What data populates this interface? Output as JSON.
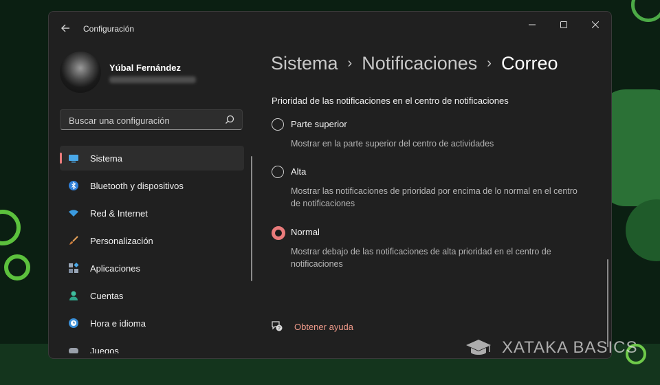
{
  "window": {
    "title": "Configuración"
  },
  "user": {
    "name": "Yúbal Fernández"
  },
  "search": {
    "placeholder": "Buscar una configuración"
  },
  "sidebar": {
    "items": [
      {
        "label": "Sistema",
        "icon": "monitor-icon",
        "active": true
      },
      {
        "label": "Bluetooth y dispositivos",
        "icon": "bluetooth-icon"
      },
      {
        "label": "Red & Internet",
        "icon": "wifi-icon"
      },
      {
        "label": "Personalización",
        "icon": "brush-icon"
      },
      {
        "label": "Aplicaciones",
        "icon": "apps-icon"
      },
      {
        "label": "Cuentas",
        "icon": "account-icon"
      },
      {
        "label": "Hora e idioma",
        "icon": "clock-globe-icon"
      },
      {
        "label": "Juegos",
        "icon": "gamepad-icon"
      }
    ]
  },
  "breadcrumb": {
    "part1": "Sistema",
    "part2": "Notificaciones",
    "current": "Correo",
    "separator": "›"
  },
  "main": {
    "section_title": "Prioridad de las notificaciones en el centro de notificaciones",
    "options": [
      {
        "label": "Parte superior",
        "description": "Mostrar en la parte superior del centro de actividades",
        "selected": false
      },
      {
        "label": "Alta",
        "description": "Mostrar las notificaciones de prioridad por encima de lo normal en el centro de notificaciones",
        "selected": false
      },
      {
        "label": "Normal",
        "description": "Mostrar debajo de las notificaciones de alta prioridad en el centro de notificaciones",
        "selected": true
      }
    ],
    "help_link": "Obtener ayuda"
  },
  "watermark": {
    "text": "XATAKA BASICS"
  },
  "colors": {
    "accent": "#e97b7b",
    "window_bg": "#202020",
    "link": "#ef9a8a"
  }
}
